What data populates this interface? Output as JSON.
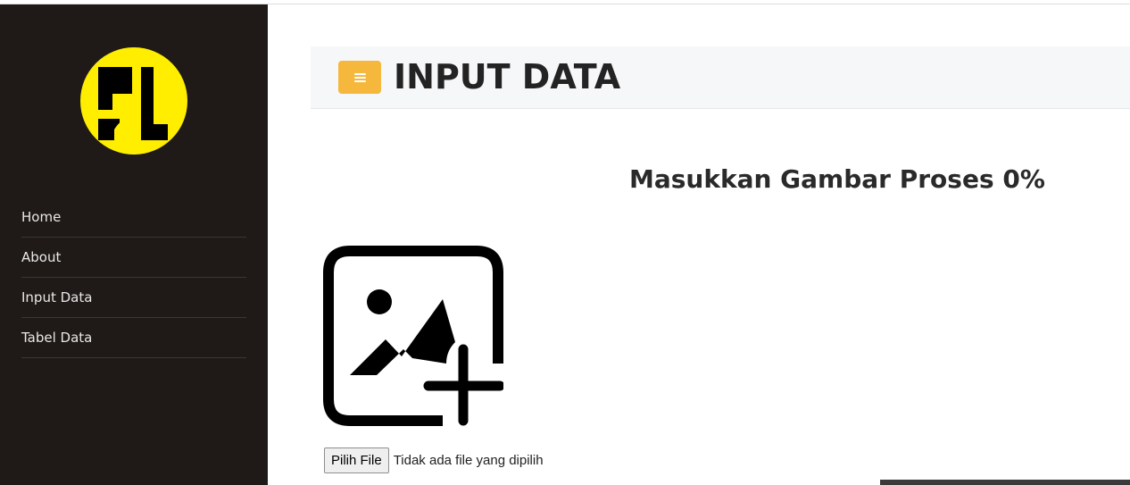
{
  "sidebar": {
    "logo_icon": "pu-logo-icon",
    "logo_color": "#ffee00",
    "items": [
      {
        "label": "Home"
      },
      {
        "label": "About"
      },
      {
        "label": "Input Data"
      },
      {
        "label": "Tabel Data"
      }
    ]
  },
  "header": {
    "menu_icon": "hamburger-icon",
    "accent": "#f5b83d",
    "title": "INPUT DATA"
  },
  "main": {
    "heading": "Masukkan Gambar Proses 0%",
    "upload_icon": "add-image-icon",
    "file_button": "Pilih File",
    "file_status": "Tidak ada file yang dipilih"
  }
}
